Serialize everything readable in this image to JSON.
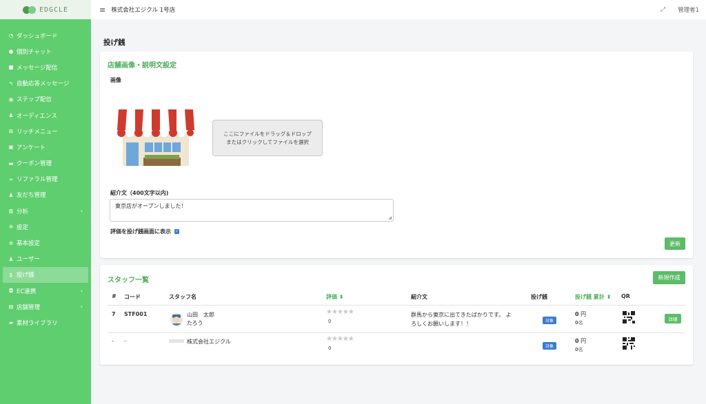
{
  "app": {
    "logo_text": "EDGCLE"
  },
  "topbar": {
    "store_name": "株式会社エジクル 1号店",
    "user": "管理者1"
  },
  "sidebar": {
    "items": [
      {
        "label": "ダッシュボード",
        "icon": "dashboard-icon"
      },
      {
        "label": "個別チャット",
        "icon": "chat-icon"
      },
      {
        "label": "メッセージ配信",
        "icon": "message-icon"
      },
      {
        "label": "自動応答メッセージ",
        "icon": "reply-icon"
      },
      {
        "label": "ステップ配信",
        "icon": "step-icon"
      },
      {
        "label": "オーディエンス",
        "icon": "users-icon"
      },
      {
        "label": "リッチメニュー",
        "icon": "grid-icon"
      },
      {
        "label": "アンケート",
        "icon": "survey-icon"
      },
      {
        "label": "クーポン管理",
        "icon": "ticket-icon"
      },
      {
        "label": "リファラル管理",
        "icon": "link-icon"
      },
      {
        "label": "友だち管理",
        "icon": "friends-icon"
      },
      {
        "label": "分析",
        "icon": "chart-icon"
      },
      {
        "label": "設定",
        "icon": "gear-icon"
      },
      {
        "label": "基本設定",
        "icon": "gear-icon"
      },
      {
        "label": "ユーザー",
        "icon": "user-icon"
      },
      {
        "label": "投げ銭",
        "icon": "dollar-icon"
      },
      {
        "label": "EC連携",
        "icon": "shop-icon"
      },
      {
        "label": "店舗管理",
        "icon": "store-icon"
      },
      {
        "label": "素材ライブラリ",
        "icon": "folder-icon"
      }
    ]
  },
  "page": {
    "title": "投げ銭"
  },
  "store_settings": {
    "title": "店舗画像・説明文設定",
    "image_label": "画像",
    "dropzone_line1": "ここにファイルをドラッグ＆ドロップ",
    "dropzone_line2": "またはクリックしてファイルを選択",
    "intro_label": "紹介文（400文字以内)",
    "intro_value": "東京店がオープンしました！",
    "show_rating_label": "評価を投げ銭画面に表示",
    "show_rating_checked": true,
    "update_button": "更新"
  },
  "staff": {
    "title": "スタッフ一覧",
    "new_button": "新規作成",
    "columns": {
      "num": "#",
      "code": "コード",
      "name": "スタッフ名",
      "rating": "評価",
      "intro": "紹介文",
      "tip": "投げ銭",
      "tip_total": "投げ銭 累計",
      "qr": "QR"
    },
    "rows": [
      {
        "num": "7",
        "code": "STF001",
        "name": "山田　太郎",
        "kana": "たろう",
        "stars": "★★★★★",
        "rating_count": "0",
        "intro_line1": "群馬から東京に出てきたばかりです。 よ",
        "intro_line2": "ろしくお願いします！！",
        "tip_badge": "対象",
        "total_amount": "0",
        "total_unit": "円",
        "total_people": "0",
        "people_unit": "名",
        "detail_button": "詳細"
      },
      {
        "num": "-",
        "code": "-",
        "name": "株式会社エジクル",
        "kana": "",
        "stars": "★★★★★",
        "rating_count": "0",
        "intro_line1": "",
        "intro_line2": "",
        "tip_badge": "対象",
        "total_amount": "0",
        "total_unit": "円",
        "total_people": "0",
        "people_unit": "名",
        "detail_button": ""
      }
    ]
  },
  "colors": {
    "sidebar": "#5fce6e",
    "accent": "#4cae5a",
    "button": "#5dbb69",
    "badge": "#3a7bd5"
  }
}
